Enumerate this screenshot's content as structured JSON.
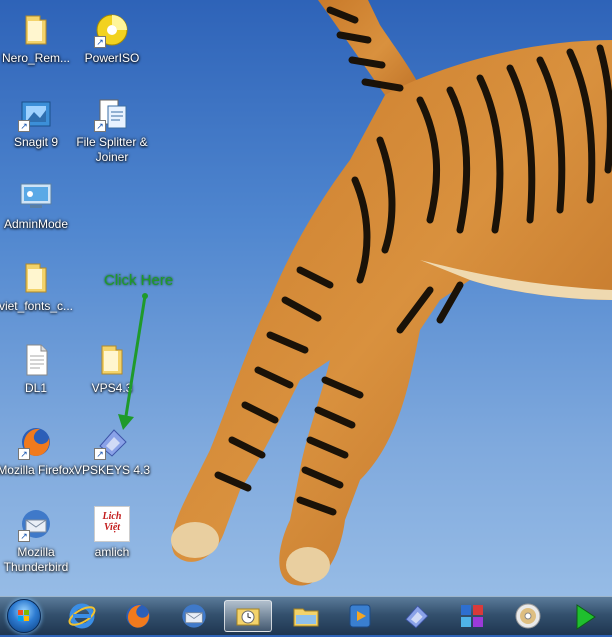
{
  "desktop": {
    "icons": [
      {
        "label": "Nero_Rem...",
        "icon": "folder-icon"
      },
      {
        "label": "PowerISO",
        "icon": "poweriso-icon"
      },
      {
        "label": "Snagit 9",
        "icon": "snagit-icon"
      },
      {
        "label": "File Splitter & Joiner",
        "icon": "file-splitter-icon"
      },
      {
        "label": "AdminMode",
        "icon": "adminmode-icon"
      },
      {
        "label": "viet_fonts_c...",
        "icon": "folder-icon"
      },
      {
        "label": "DL1",
        "icon": "document-icon"
      },
      {
        "label": "VPS4.3",
        "icon": "folder-icon"
      },
      {
        "label": "Mozilla Firefox",
        "icon": "firefox-icon"
      },
      {
        "label": "VPSKEYS 4.3",
        "icon": "vpskeys-icon"
      },
      {
        "label": "Mozilla Thunderbird",
        "icon": "thunderbird-icon"
      },
      {
        "label": "amlich",
        "icon": "lich-viet-icon"
      }
    ],
    "lich_viet_logo": "Lich Việt"
  },
  "annotation": {
    "text": "Click Here",
    "color": "#1f9a2b"
  },
  "taskbar": {
    "items": [
      {
        "name": "start-button",
        "icon": "windows-orb-icon"
      },
      {
        "name": "internet-explorer",
        "icon": "ie-icon"
      },
      {
        "name": "firefox",
        "icon": "firefox-icon"
      },
      {
        "name": "thunderbird",
        "icon": "thunderbird-icon"
      },
      {
        "name": "outlook-calendar",
        "icon": "calendar-clock-icon",
        "active": true
      },
      {
        "name": "windows-explorer",
        "icon": "folder-icon"
      },
      {
        "name": "media-player",
        "icon": "media-player-icon"
      },
      {
        "name": "vpskeys",
        "icon": "vpskeys-icon"
      },
      {
        "name": "app-grid",
        "icon": "app-grid-icon"
      },
      {
        "name": "dvd-burner",
        "icon": "disc-icon"
      },
      {
        "name": "green-arrow-app",
        "icon": "green-arrow-icon"
      }
    ]
  }
}
